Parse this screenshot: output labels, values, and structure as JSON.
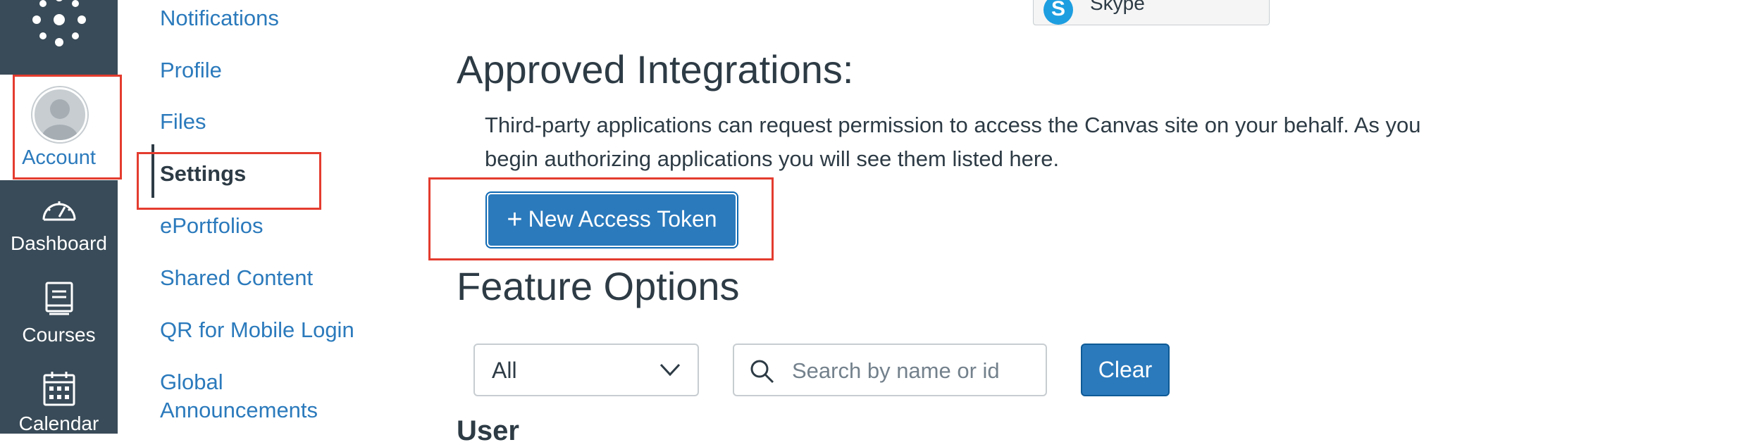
{
  "global_nav": {
    "account_label": "Account",
    "items": [
      {
        "label": "Dashboard",
        "icon": "dashboard-icon"
      },
      {
        "label": "Courses",
        "icon": "courses-icon"
      },
      {
        "label": "Calendar",
        "icon": "calendar-icon"
      }
    ]
  },
  "secondary_nav": {
    "items": [
      {
        "label": "Notifications"
      },
      {
        "label": "Profile"
      },
      {
        "label": "Files"
      },
      {
        "label": "Settings",
        "active": true
      },
      {
        "label": "ePortfolios"
      },
      {
        "label": "Shared Content"
      },
      {
        "label": "QR for Mobile Login"
      },
      {
        "label": "Global"
      },
      {
        "label": "Announcements"
      }
    ]
  },
  "main": {
    "skype_label": "Skype",
    "approved": {
      "heading": "Approved Integrations:",
      "description": "Third-party applications can request permission to access the Canvas site on your behalf. As you begin authorizing applications you will see them listed here.",
      "new_token_label": "New Access Token"
    },
    "features": {
      "heading": "Feature Options",
      "filter_value": "All",
      "search_placeholder": "Search by name or id",
      "clear_label": "Clear",
      "subheading": "User"
    }
  },
  "colors": {
    "nav_bg": "#394b58",
    "link": "#2b7abc",
    "highlight": "#e43c2f"
  }
}
